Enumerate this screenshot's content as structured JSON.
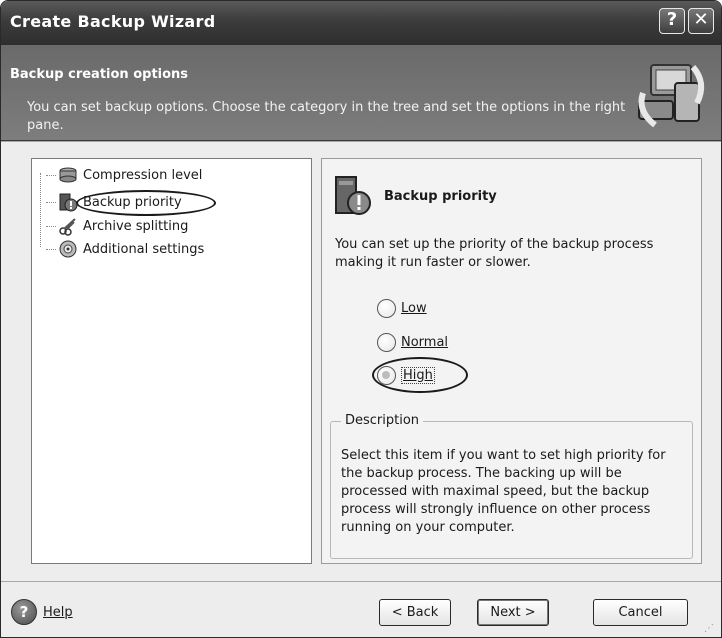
{
  "window": {
    "title": "Create Backup Wizard",
    "help_glyph": "?",
    "close_glyph": "✕"
  },
  "header": {
    "title": "Backup creation options",
    "description": "You can set backup options. Choose the category in the tree and set the options in the right pane."
  },
  "tree": {
    "items": [
      {
        "label": "Compression level",
        "icon": "compression-icon"
      },
      {
        "label": "Backup priority",
        "icon": "priority-icon",
        "selected": true
      },
      {
        "label": "Archive splitting",
        "icon": "scissors-icon"
      },
      {
        "label": "Additional settings",
        "icon": "settings-disc-icon"
      }
    ]
  },
  "panel": {
    "title": "Backup priority",
    "description": "You can set up the priority of the backup process making it run faster or slower.",
    "options": [
      {
        "label": "Low",
        "checked": false
      },
      {
        "label": "Normal",
        "checked": false
      },
      {
        "label": "High",
        "checked": true
      }
    ],
    "group_title": "Description",
    "group_text": "Select this item if you want to set high priority for the backup process. The backing up will be processed with maximal speed, but the backup process will strongly influence on other process running on your computer."
  },
  "footer": {
    "help_label": "Help",
    "back_label": "< Back",
    "next_label": "Next >",
    "cancel_label": "Cancel"
  }
}
